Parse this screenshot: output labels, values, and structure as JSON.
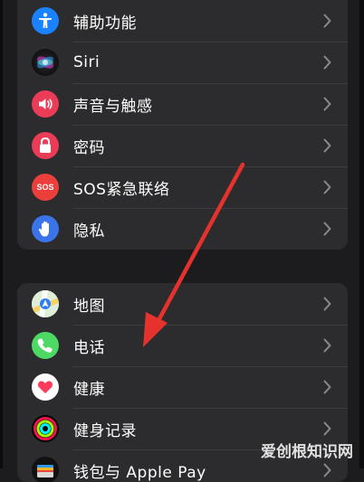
{
  "settings_group_1": {
    "items": [
      {
        "label": "辅助功能",
        "icon": "accessibility-icon",
        "color": "#1a82ff"
      },
      {
        "label": "Siri",
        "icon": "siri-icon",
        "color": "#1c1c1e"
      },
      {
        "label": "声音与触感",
        "icon": "speaker-icon",
        "color": "#ea3b57"
      },
      {
        "label": "密码",
        "icon": "lock-icon",
        "color": "#ea3b57"
      },
      {
        "label": "SOS紧急联络",
        "icon": "sos-icon",
        "color": "#ec3f3b",
        "icon_text": "SOS"
      },
      {
        "label": "隐私",
        "icon": "hand-icon",
        "color": "#3a74e8"
      }
    ]
  },
  "settings_group_2": {
    "items": [
      {
        "label": "地图",
        "icon": "maps-icon",
        "color": "#ffffff"
      },
      {
        "label": "电话",
        "icon": "phone-icon",
        "color": "#4cd964"
      },
      {
        "label": "健康",
        "icon": "heart-icon",
        "color": "#ffffff"
      },
      {
        "label": "健身记录",
        "icon": "activity-rings-icon",
        "color": "#000000"
      },
      {
        "label": "钱包与 Apple Pay",
        "icon": "wallet-icon",
        "color": "#111111"
      }
    ]
  },
  "annotation": {
    "arrow_color": "#e5322d"
  },
  "watermark": {
    "text": "爱创根知识网"
  }
}
